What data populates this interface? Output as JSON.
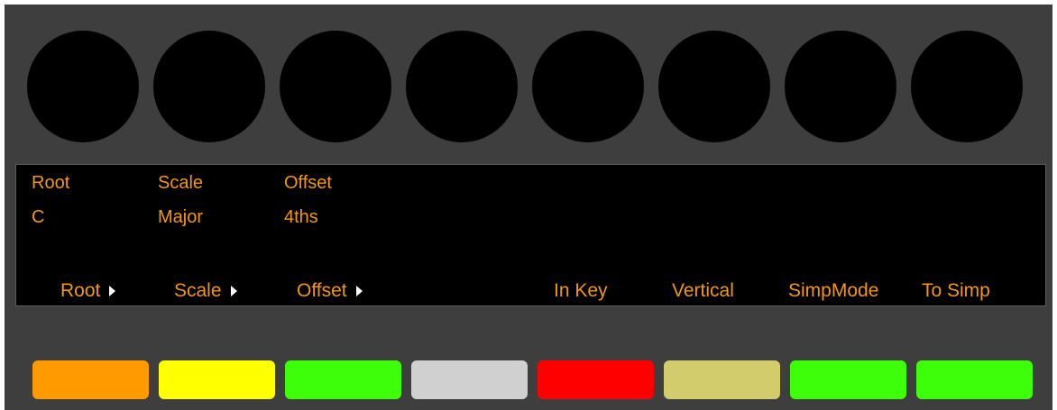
{
  "knobs": [
    "knob-1",
    "knob-2",
    "knob-3",
    "knob-4",
    "knob-5",
    "knob-6",
    "knob-7",
    "knob-8"
  ],
  "display": {
    "params": [
      {
        "name": "Root",
        "value": "C"
      },
      {
        "name": "Scale",
        "value": "Major"
      },
      {
        "name": "Offset",
        "value": "4ths"
      }
    ],
    "soft_buttons": [
      {
        "label": "Root",
        "icon": "arrow-right-icon"
      },
      {
        "label": "Scale",
        "icon": "arrow-right-icon"
      },
      {
        "label": "Offset",
        "icon": "arrow-right-icon"
      },
      {
        "label": "",
        "icon": ""
      },
      {
        "label": "In Key",
        "icon": ""
      },
      {
        "label": "Vertical",
        "icon": ""
      },
      {
        "label": "SimpMode",
        "icon": ""
      },
      {
        "label": "To Simp",
        "icon": ""
      }
    ]
  },
  "pads": [
    {
      "color": "#ff9a00"
    },
    {
      "color": "#ffff00"
    },
    {
      "color": "#3dff0a"
    },
    {
      "color": "#d0d0d0"
    },
    {
      "color": "#ff0000"
    },
    {
      "color": "#d2cc6c"
    },
    {
      "color": "#3dff0a"
    },
    {
      "color": "#3dff0a"
    }
  ],
  "colors": {
    "text": "#f2970f",
    "panel": "#3e3e3e",
    "display_bg": "#000000"
  }
}
